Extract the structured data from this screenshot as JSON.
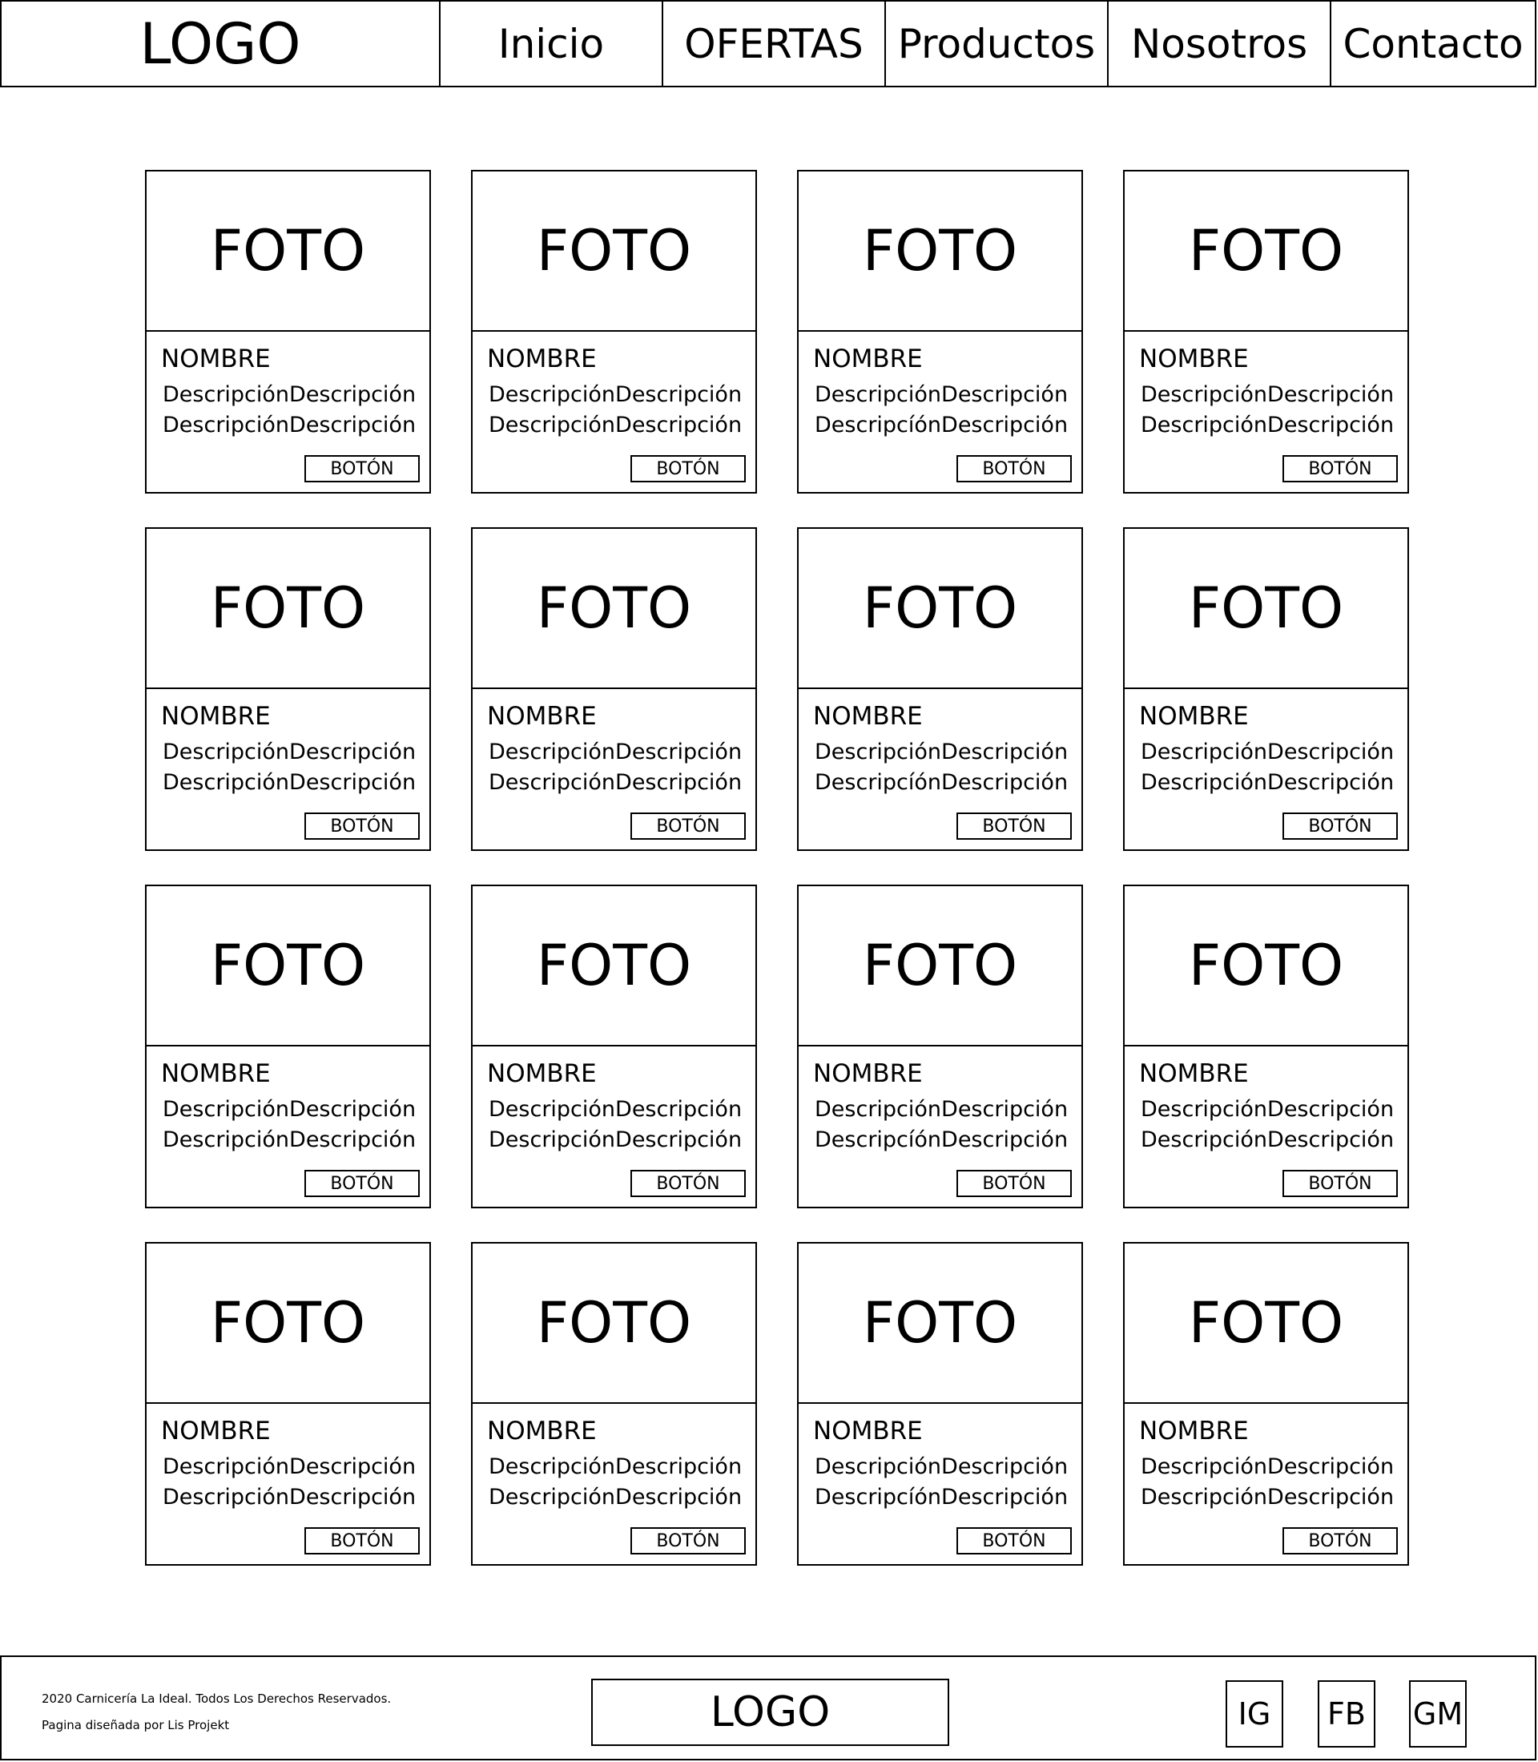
{
  "header": {
    "logo": "LOGO",
    "nav": [
      "Inicio",
      "OFERTAS",
      "Productos",
      "Nosotros",
      "Contacto"
    ]
  },
  "products": [
    {
      "photo": "FOTO",
      "name": "NOMBRE",
      "desc1": "DescripciónDescripción",
      "desc2": "DescripciónDescripción",
      "button": "BOTÓN"
    },
    {
      "photo": "FOTO",
      "name": "NOMBRE",
      "desc1": "DescripciónDescripción",
      "desc2": "DescripciónDescripción",
      "button": "BOTÓN"
    },
    {
      "photo": "FOTO",
      "name": "NOMBRE",
      "desc1": "DescripciónDescripción",
      "desc2": "DescripcíónDescripción",
      "button": "BOTÓN"
    },
    {
      "photo": "FOTO",
      "name": "NOMBRE",
      "desc1": "DescripciónDescripción",
      "desc2": "DescripciónDescripción",
      "button": "BOTÓN"
    },
    {
      "photo": "FOTO",
      "name": "NOMBRE",
      "desc1": "DescripciónDescripción",
      "desc2": "DescripciónDescripción",
      "button": "BOTÓN"
    },
    {
      "photo": "FOTO",
      "name": "NOMBRE",
      "desc1": "DescripciónDescripción",
      "desc2": "DescripciónDescripción",
      "button": "BOTÓN"
    },
    {
      "photo": "FOTO",
      "name": "NOMBRE",
      "desc1": "DescripciónDescripción",
      "desc2": "DescripcíónDescripción",
      "button": "BOTÓN"
    },
    {
      "photo": "FOTO",
      "name": "NOMBRE",
      "desc1": "DescripciónDescripción",
      "desc2": "DescripciónDescripción",
      "button": "BOTÓN"
    },
    {
      "photo": "FOTO",
      "name": "NOMBRE",
      "desc1": "DescripciónDescripción",
      "desc2": "DescripciónDescripción",
      "button": "BOTÓN"
    },
    {
      "photo": "FOTO",
      "name": "NOMBRE",
      "desc1": "DescripciónDescripción",
      "desc2": "DescripciónDescripción",
      "button": "BOTÓN"
    },
    {
      "photo": "FOTO",
      "name": "NOMBRE",
      "desc1": "DescripciónDescripción",
      "desc2": "DescripcíónDescripción",
      "button": "BOTÓN"
    },
    {
      "photo": "FOTO",
      "name": "NOMBRE",
      "desc1": "DescripciónDescripción",
      "desc2": "DescripciónDescripción",
      "button": "BOTÓN"
    },
    {
      "photo": "FOTO",
      "name": "NOMBRE",
      "desc1": "DescripciónDescripción",
      "desc2": "DescripciónDescripción",
      "button": "BOTÓN"
    },
    {
      "photo": "FOTO",
      "name": "NOMBRE",
      "desc1": "DescripciónDescripción",
      "desc2": "DescripciónDescripción",
      "button": "BOTÓN"
    },
    {
      "photo": "FOTO",
      "name": "NOMBRE",
      "desc1": "DescripciónDescripción",
      "desc2": "DescripcíónDescripción",
      "button": "BOTÓN"
    },
    {
      "photo": "FOTO",
      "name": "NOMBRE",
      "desc1": "DescripciónDescripción",
      "desc2": "DescripciónDescripción",
      "button": "BOTÓN"
    }
  ],
  "footer": {
    "copyright": "2020 Carnicería La Ideal. Todos Los Derechos Reservados.",
    "credit": "Pagina diseñada por Lis Projekt",
    "logo": "LOGO",
    "social": [
      "IG",
      "FB",
      "GM"
    ]
  }
}
